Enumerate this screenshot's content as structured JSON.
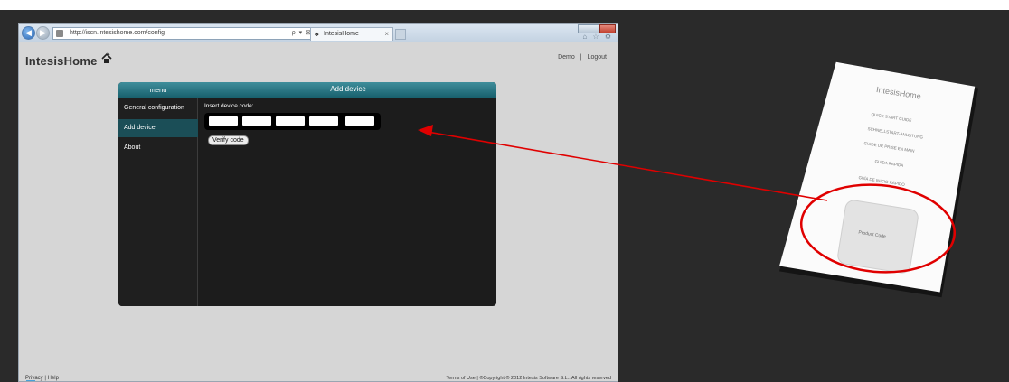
{
  "browser": {
    "address": "http://iscn.intesishome.com/config",
    "address_tools": "ρ ▾ ⊠ C ×",
    "tab_title": "IntesisHome",
    "tab_close": "×",
    "nav_back": "◀",
    "nav_forward": "▶",
    "util_icons": "⌂ ☆ ⚙"
  },
  "page": {
    "logo": "IntesisHome",
    "top_links": [
      "Demo",
      "|",
      "Logout"
    ],
    "menu_title": "menu",
    "menu_items": [
      "General configuration",
      "Add device",
      "About"
    ],
    "active_item": "Add device",
    "content_title": "Add device",
    "insert_label": "Insert device code:",
    "verify_button": "Verify code",
    "footer_left": "Privacy  |  Help",
    "footer_right": "Terms of Use  |  ©Copyright ® 2012 Intesis Software S.L.. All rights reserved"
  },
  "booklet": {
    "logo": "IntesisHome",
    "lines": [
      "QUICK START GUIDE",
      "SCHNELLSTART-ANLEITUNG",
      "GUIDE DE PRISE EN MAIN",
      "GUIDA RAPIDA",
      "GUÍA DE INICIO RÁPIDO"
    ],
    "product_label": "Product Code"
  },
  "colors": {
    "panel_header": "#2a7a86",
    "active_menu": "#1b4e57",
    "panel_bg": "#1c1c1c",
    "page_bg": "#d6d6d6",
    "annotation": "#e00000",
    "background": "#2a2a2a"
  }
}
